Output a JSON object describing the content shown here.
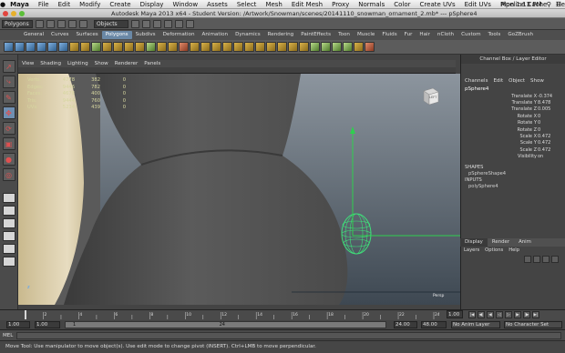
{
  "mac_menubar": {
    "app": "Maya",
    "items": [
      "File",
      "Edit",
      "Modify",
      "Create",
      "Display",
      "Window",
      "Assets",
      "Select",
      "Mesh",
      "Edit Mesh",
      "Proxy",
      "Normals",
      "Color",
      "Create UVs",
      "Edit UVs",
      "Pipeline Cache",
      "Help"
    ],
    "clock": "Mon 1:13 PM"
  },
  "window": {
    "title": "Autodesk Maya 2013 x64 - Student Version: /Artwork/Snowman/scenes/20141110_snowman_ornament_2.mb* --- pSphere4"
  },
  "status_line": {
    "mode": "Polygons",
    "selection_mask": "Objects"
  },
  "shelf": {
    "tabs": [
      "General",
      "Curves",
      "Surfaces",
      "Polygons",
      "Subdivs",
      "Deformation",
      "Animation",
      "Dynamics",
      "Rendering",
      "PaintEffects",
      "Toon",
      "Muscle",
      "Fluids",
      "Fur",
      "Hair",
      "nCloth",
      "Custom",
      "Tools",
      "GoZBrush"
    ],
    "active_tab": "Polygons"
  },
  "panel_menu": {
    "items": [
      "View",
      "Shading",
      "Lighting",
      "Show",
      "Renderer",
      "Panels"
    ]
  },
  "hud": {
    "rows": [
      {
        "label": "Verts:",
        "a": "4778",
        "b": "382",
        "c": "0"
      },
      {
        "label": "Edges:",
        "a": "9446",
        "b": "782",
        "c": "0"
      },
      {
        "label": "Faces:",
        "a": "4678",
        "b": "400",
        "c": "0"
      },
      {
        "label": "Tris:",
        "a": "9444",
        "b": "760",
        "c": "0"
      },
      {
        "label": "UVs:",
        "a": "5234",
        "b": "439",
        "c": "0"
      }
    ],
    "viewcube_label": "LEFT",
    "camera": "Persp",
    "axis_label": "z"
  },
  "channel_box": {
    "title": "Channel Box / Layer Editor",
    "menu": [
      "Channels",
      "Edit",
      "Object",
      "Show"
    ],
    "object": "pSphere4",
    "attributes": [
      {
        "name": "Translate X",
        "value": "-0.374"
      },
      {
        "name": "Translate Y",
        "value": "8.478"
      },
      {
        "name": "Translate Z",
        "value": "0.005"
      },
      {
        "name": "Rotate X",
        "value": "0"
      },
      {
        "name": "Rotate Y",
        "value": "0"
      },
      {
        "name": "Rotate Z",
        "value": "0"
      },
      {
        "name": "Scale X",
        "value": "0.472"
      },
      {
        "name": "Scale Y",
        "value": "0.472"
      },
      {
        "name": "Scale Z",
        "value": "0.472"
      },
      {
        "name": "Visibility",
        "value": "on"
      }
    ],
    "shapes_header": "SHAPES",
    "shape": "pSphereShape4",
    "inputs_header": "INPUTS",
    "input": "polySphere4"
  },
  "layer_editor": {
    "tabs": [
      "Display",
      "Render",
      "Anim"
    ],
    "active_tab": "Display",
    "menu": [
      "Layers",
      "Options",
      "Help"
    ]
  },
  "time_slider": {
    "ticks": [
      "2",
      "4",
      "6",
      "8",
      "10",
      "12",
      "14",
      "16",
      "18",
      "20",
      "22",
      "24"
    ],
    "current_frame": "1.00"
  },
  "range_slider": {
    "start": "1.00",
    "playback_start": "1.00",
    "range_left": "1",
    "range_right": "24",
    "playback_end": "24.00",
    "end": "48.00",
    "anim_layer": "No Anim Layer",
    "character_set": "No Character Set"
  },
  "command_line": {
    "label": "MEL"
  },
  "help_line": {
    "text": "Move Tool: Use manipulator to move object(s). Use edit mode to change pivot (INSERT). Ctrl+LMB to move perpendicular."
  },
  "colors": {
    "selection_green": "#3fe07a",
    "shelf_active": "#6a88a6",
    "viewport_bg": "#8b939c",
    "hud_text": "#d6d6a0"
  }
}
